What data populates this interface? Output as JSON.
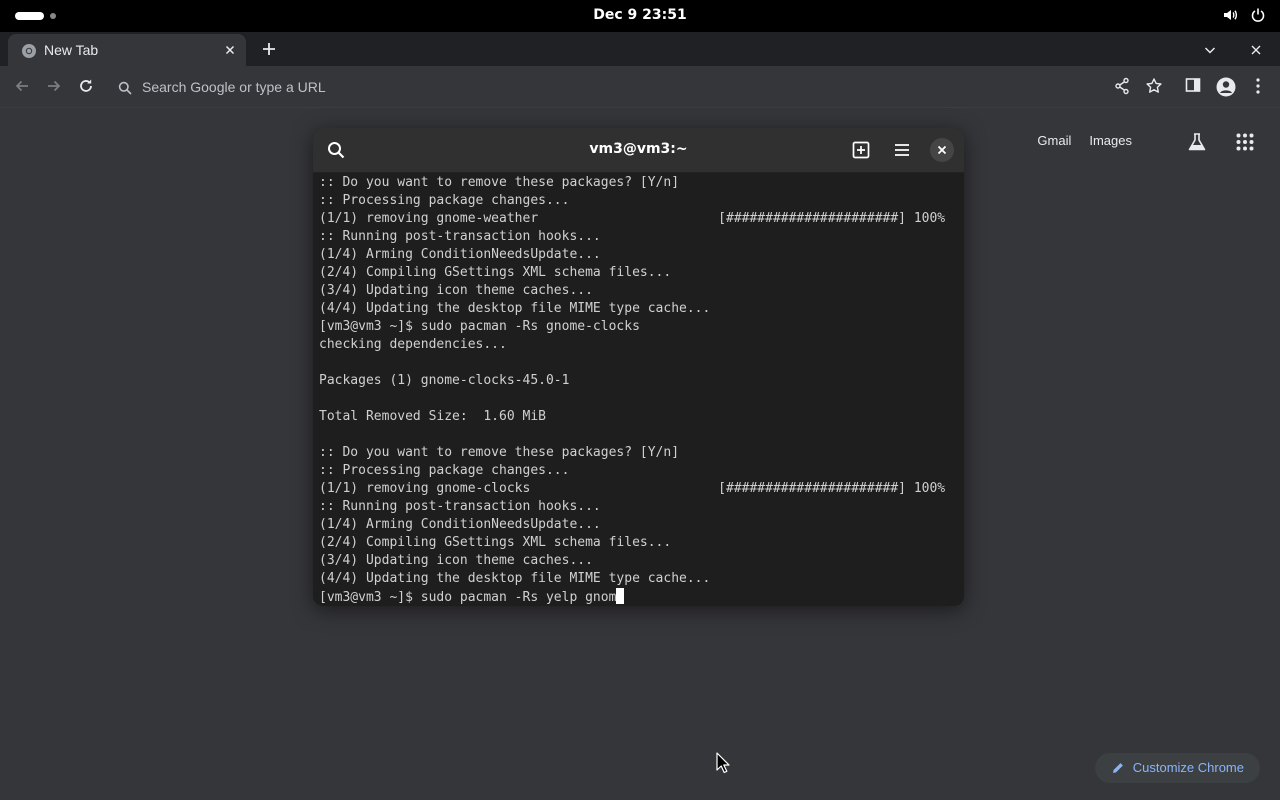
{
  "topbar": {
    "clock": "Dec 9  23:51",
    "icons": [
      "volume-icon",
      "power-icon"
    ]
  },
  "browser": {
    "tab": {
      "title": "New Tab",
      "favicon": "chrome-icon"
    },
    "omnibox": {
      "placeholder": "Search Google or type a URL"
    },
    "ntp": {
      "links": [
        "Gmail",
        "Images"
      ],
      "customize_label": "Customize Chrome"
    }
  },
  "terminal": {
    "title": "vm3@vm3:~",
    "lines": [
      ":: Do you want to remove these packages? [Y/n]",
      ":: Processing package changes...",
      "(1/1) removing gnome-weather                       [######################] 100%",
      ":: Running post-transaction hooks...",
      "(1/4) Arming ConditionNeedsUpdate...",
      "(2/4) Compiling GSettings XML schema files...",
      "(3/4) Updating icon theme caches...",
      "(4/4) Updating the desktop file MIME type cache...",
      "[vm3@vm3 ~]$ sudo pacman -Rs gnome-clocks",
      "checking dependencies...",
      "",
      "Packages (1) gnome-clocks-45.0-1",
      "",
      "Total Removed Size:  1.60 MiB",
      "",
      ":: Do you want to remove these packages? [Y/n]",
      ":: Processing package changes...",
      "(1/1) removing gnome-clocks                        [######################] 100%",
      ":: Running post-transaction hooks...",
      "(1/4) Arming ConditionNeedsUpdate...",
      "(2/4) Compiling GSettings XML schema files...",
      "(3/4) Updating icon theme caches...",
      "(4/4) Updating the desktop file MIME type cache..."
    ],
    "prompt_line": "[vm3@vm3 ~]$ sudo pacman -Rs yelp gnom"
  }
}
